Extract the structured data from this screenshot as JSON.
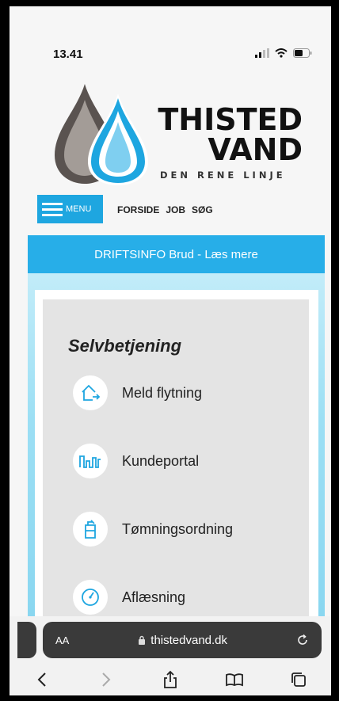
{
  "status": {
    "time": "13.41"
  },
  "brand": {
    "name_line1": "THISTED",
    "name_line2": "VAND",
    "tagline": "DEN RENE LINJE"
  },
  "nav": {
    "menu_label": "MENU",
    "links": [
      "FORSIDE",
      "JOB",
      "SØG"
    ]
  },
  "banner": {
    "text": "DRIFTSINFO Brud - Læs mere"
  },
  "selfservice": {
    "title": "Selvbetjening",
    "items": [
      {
        "label": "Meld flytning",
        "icon": "house-move-icon"
      },
      {
        "label": "Kundeportal",
        "icon": "meter-graph-icon"
      },
      {
        "label": "Tømningsordning",
        "icon": "tank-icon"
      },
      {
        "label": "Aflæsning",
        "icon": "gauge-icon"
      }
    ]
  },
  "browser": {
    "aa_label": "AA",
    "url": "thistedvand.dk"
  },
  "colors": {
    "accent": "#1ea6e0",
    "banner": "#27aee8",
    "card": "#e4e4e4"
  }
}
